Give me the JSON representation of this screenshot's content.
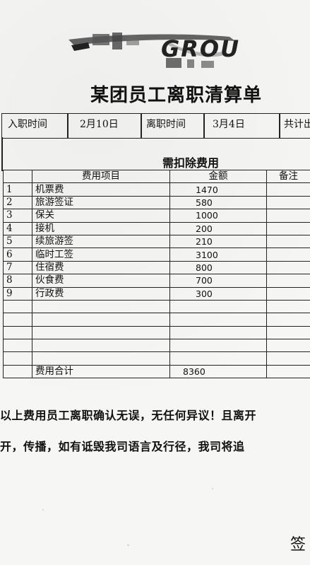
{
  "logo": {
    "text": "GROU"
  },
  "title": {
    "lead": "",
    "main": "某团员工离职清算单"
  },
  "header": {
    "entry_label": "入职时间",
    "entry_value": "2月10日",
    "leave_label": "离职时间",
    "leave_value": "3月4日",
    "total_label": "共计出"
  },
  "section_title": "需扣除费用",
  "table": {
    "headers": {
      "no": "",
      "item": "费用项目",
      "amount": "金额",
      "note": "备注"
    },
    "rows": [
      {
        "no": "1",
        "item": "机票费",
        "amount": "1470"
      },
      {
        "no": "2",
        "item": "旅游签证",
        "amount": "580"
      },
      {
        "no": "3",
        "item": "保关",
        "amount": "1000"
      },
      {
        "no": "4",
        "item": "接机",
        "amount": "200"
      },
      {
        "no": "5",
        "item": "续旅游签",
        "amount": "210"
      },
      {
        "no": "6",
        "item": "临时工签",
        "amount": "3100"
      },
      {
        "no": "7",
        "item": "住宿费",
        "amount": "800"
      },
      {
        "no": "8",
        "item": "伙食费",
        "amount": "700"
      },
      {
        "no": "9",
        "item": "行政费",
        "amount": "300"
      }
    ],
    "total_label": "费用合计",
    "total_value": "8360"
  },
  "statement": {
    "line1": "以上费用员工离职确认无误，无任何异议！且离开",
    "line2": "开，传播，如有诋毁我司语言及行径，我司将追"
  },
  "signature_label": "签"
}
